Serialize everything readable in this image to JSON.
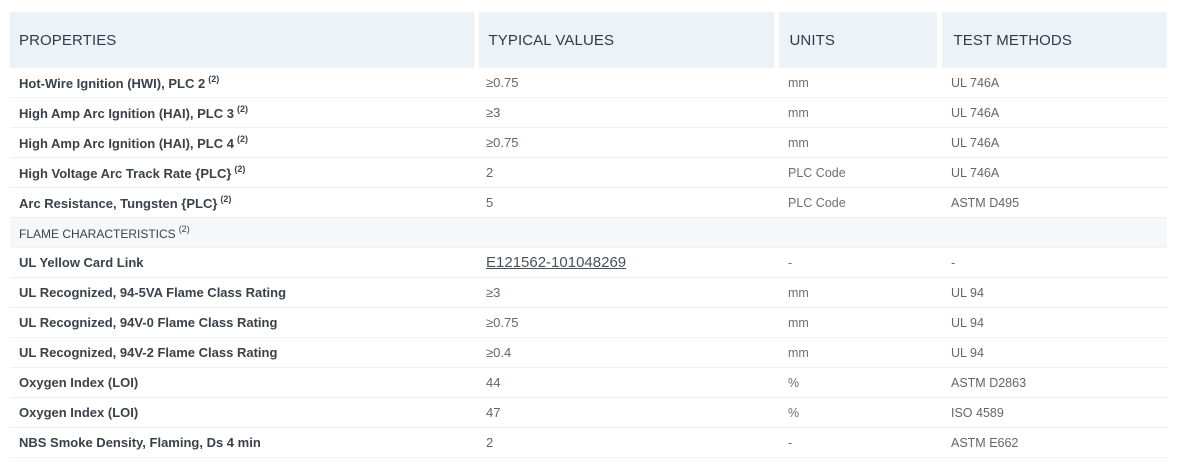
{
  "headers": {
    "properties": "PROPERTIES",
    "typical_values": "TYPICAL VALUES",
    "units": "UNITS",
    "test_methods": "TEST METHODS"
  },
  "rows": [
    {
      "property": "Hot-Wire Ignition (HWI), PLC 2",
      "note": "(2)",
      "value": "≥0.75",
      "unit": "mm",
      "method": "UL 746A"
    },
    {
      "property": "High Amp Arc Ignition (HAI), PLC 3",
      "note": "(2)",
      "value": "≥3",
      "unit": "mm",
      "method": "UL 746A"
    },
    {
      "property": "High Amp Arc Ignition (HAI), PLC 4",
      "note": "(2)",
      "value": "≥0.75",
      "unit": "mm",
      "method": "UL 746A"
    },
    {
      "property": "High Voltage Arc Track Rate {PLC}",
      "note": "(2)",
      "value": "2",
      "unit": "PLC Code",
      "method": "UL 746A"
    },
    {
      "property": "Arc Resistance, Tungsten {PLC}",
      "note": "(2)",
      "value": "5",
      "unit": "PLC Code",
      "method": "ASTM D495"
    }
  ],
  "section": {
    "label": "FLAME CHARACTERISTICS",
    "note": "(2)"
  },
  "link_row": {
    "property": "UL Yellow Card Link",
    "value": "E121562-101048269",
    "unit": "-",
    "method": "-"
  },
  "rows2": [
    {
      "property": "UL Recognized, 94-5VA Flame Class Rating",
      "value": "≥3",
      "unit": "mm",
      "method": "UL 94"
    },
    {
      "property": "UL Recognized, 94V-0 Flame Class Rating",
      "value": "≥0.75",
      "unit": "mm",
      "method": "UL 94"
    },
    {
      "property": "UL Recognized, 94V-2 Flame Class Rating",
      "value": "≥0.4",
      "unit": "mm",
      "method": "UL 94"
    },
    {
      "property": "Oxygen Index (LOI)",
      "value": "44",
      "unit": "%",
      "method": "ASTM D2863"
    },
    {
      "property": "Oxygen Index (LOI)",
      "value": "47",
      "unit": "%",
      "method": "ISO 4589"
    },
    {
      "property": "NBS Smoke Density, Flaming, Ds 4 min",
      "value": "2",
      "unit": "-",
      "method": "ASTM E662"
    }
  ]
}
